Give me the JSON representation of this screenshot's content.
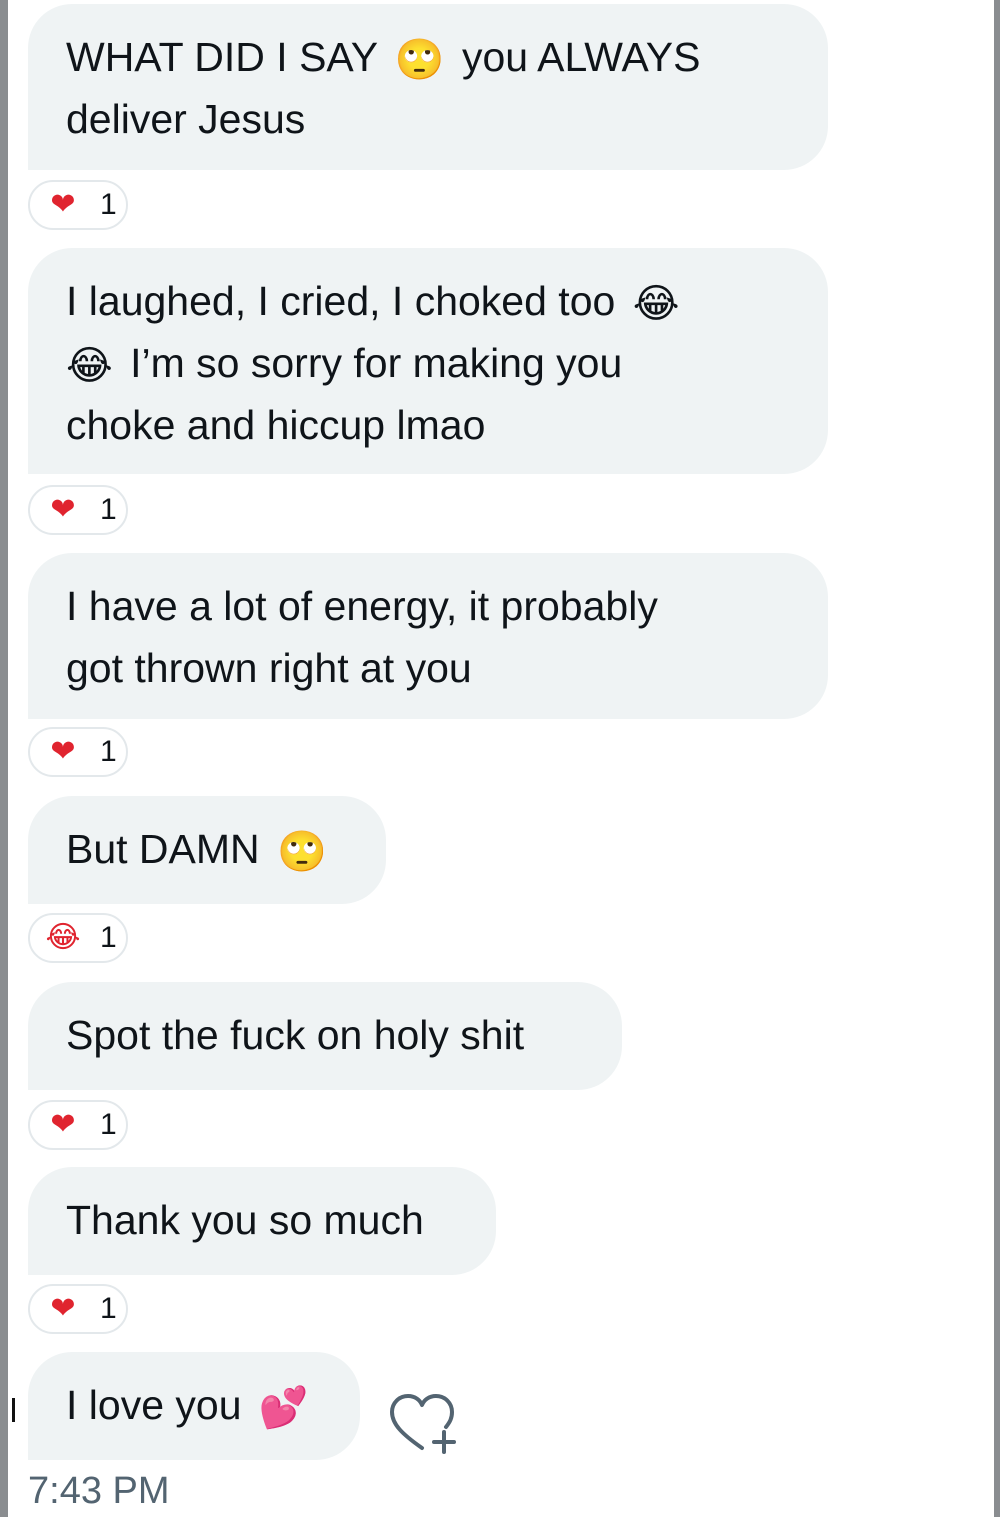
{
  "messages": [
    {
      "parts": [
        "WHAT DID I SAY ",
        "🙄",
        " you ALWAYS deliver Jesus"
      ],
      "reaction": {
        "emoji": "❤",
        "count": "1"
      }
    },
    {
      "parts": [
        "I laughed, I cried, I choked too ",
        "😂",
        "😂",
        " I’m so sorry for making you choke and hiccup lmao"
      ],
      "reaction": {
        "emoji": "❤",
        "count": "1"
      }
    },
    {
      "parts": [
        "I have a lot of energy, it probably got thrown right at you"
      ],
      "reaction": {
        "emoji": "❤",
        "count": "1"
      }
    },
    {
      "parts": [
        "But DAMN ",
        "🙄"
      ],
      "reaction": {
        "emoji": "😂",
        "count": "1"
      }
    },
    {
      "parts": [
        "Spot the fuck on holy shit"
      ],
      "reaction": {
        "emoji": "❤",
        "count": "1"
      }
    },
    {
      "parts": [
        "Thank you so much"
      ],
      "reaction": {
        "emoji": "❤",
        "count": "1"
      }
    },
    {
      "parts": [
        "I love you ",
        "💕"
      ]
    }
  ],
  "timestamp": "7:43 PM",
  "icons": {
    "add_reaction": "heart-plus-icon"
  },
  "colors": {
    "bubble_background": "#eff3f4",
    "heart": "#e0242f",
    "timestamp_text": "#536471",
    "frame": "#8a8d90"
  }
}
